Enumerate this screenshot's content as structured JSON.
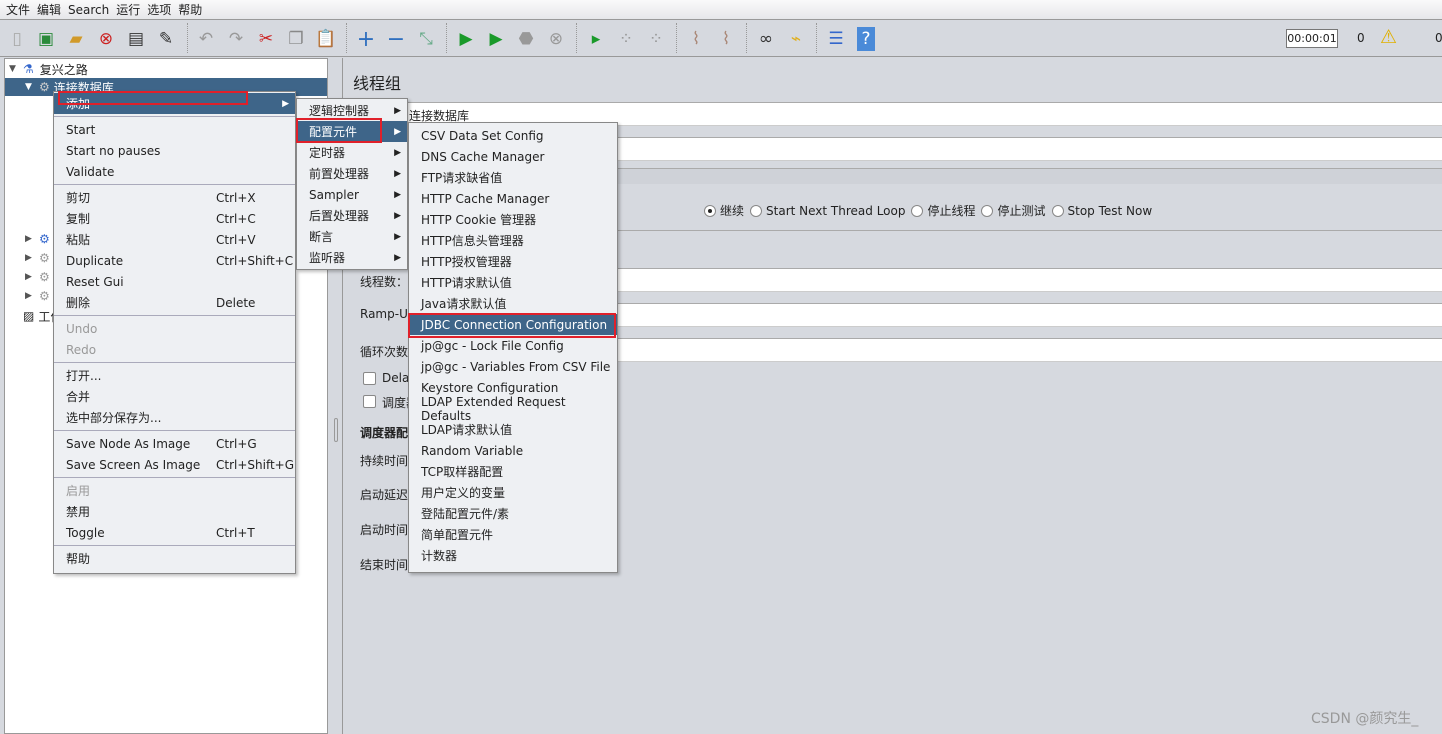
{
  "menubar": [
    "文件",
    "编辑",
    "Search",
    "运行",
    "选项",
    "帮助"
  ],
  "toolbar": {
    "timer": "00:00:01",
    "active_count": "0",
    "error_count": "0",
    "icons": [
      "new-icon",
      "templates-icon",
      "open-icon",
      "close-icon",
      "save-icon",
      "save-as-icon",
      "undo-icon",
      "redo-icon",
      "cut-icon",
      "copy-icon",
      "paste-icon",
      "expand-icon",
      "collapse-icon",
      "toggle-icon",
      "start-icon",
      "start-no-pause-icon",
      "stop-icon",
      "shutdown-icon",
      "remote-start-icon",
      "remote-stop-icon",
      "remote-exit-icon",
      "clear-icon",
      "clear-all-icon",
      "search-icon",
      "reset-search-icon",
      "function-helper-icon",
      "help-icon",
      "warning-icon"
    ]
  },
  "tree": {
    "root": "复兴之路",
    "selected": "连接数据库",
    "workbench": "工作台"
  },
  "panel": {
    "title": "线程组",
    "name_value": "连接数据库",
    "radios": [
      "继续",
      "Start Next Thread Loop",
      "停止线程",
      "停止测试",
      "Stop Test Now"
    ],
    "selected_radio": 0,
    "threads_label": "线程数：",
    "rampup_label": "Ramp-U",
    "loop_label": "循环次数",
    "delay_label": "Dela",
    "scheduler_label": "调度器",
    "scheduler_section": "调度器配",
    "duration_label": "持续时间",
    "startup_delay_label": "启动延迟",
    "start_time_label": "启动时间",
    "end_time_label": "结束时间"
  },
  "context_menu": [
    {
      "label": "添加",
      "arrow": true,
      "highlight": true
    },
    {
      "sep": true
    },
    {
      "label": "Start"
    },
    {
      "label": "Start no pauses"
    },
    {
      "label": "Validate"
    },
    {
      "sep": true
    },
    {
      "label": "剪切",
      "shortcut": "Ctrl+X"
    },
    {
      "label": "复制",
      "shortcut": "Ctrl+C"
    },
    {
      "label": "粘贴",
      "shortcut": "Ctrl+V"
    },
    {
      "label": "Duplicate",
      "shortcut": "Ctrl+Shift+C"
    },
    {
      "label": "Reset Gui"
    },
    {
      "label": "删除",
      "shortcut": "Delete"
    },
    {
      "sep": true
    },
    {
      "label": "Undo",
      "disabled": true
    },
    {
      "label": "Redo",
      "disabled": true
    },
    {
      "sep": true
    },
    {
      "label": "打开..."
    },
    {
      "label": "合并"
    },
    {
      "label": "选中部分保存为..."
    },
    {
      "sep": true
    },
    {
      "label": "Save Node As Image",
      "shortcut": "Ctrl+G"
    },
    {
      "label": "Save Screen As Image",
      "shortcut": "Ctrl+Shift+G"
    },
    {
      "sep": true
    },
    {
      "label": "启用",
      "disabled": true
    },
    {
      "label": "禁用"
    },
    {
      "label": "Toggle",
      "shortcut": "Ctrl+T"
    },
    {
      "sep": true
    },
    {
      "label": "帮助"
    }
  ],
  "submenu_add": [
    "逻辑控制器",
    "配置元件",
    "定时器",
    "前置处理器",
    "Sampler",
    "后置处理器",
    "断言",
    "监听器"
  ],
  "submenu_add_selected": 1,
  "submenu_config": [
    "CSV Data Set Config",
    "DNS Cache Manager",
    "FTP请求缺省值",
    "HTTP Cache Manager",
    "HTTP Cookie 管理器",
    "HTTP信息头管理器",
    "HTTP授权管理器",
    "HTTP请求默认值",
    "Java请求默认值",
    "JDBC Connection Configuration",
    "jp@gc - Lock File Config",
    "jp@gc - Variables From CSV File",
    "Keystore Configuration",
    "LDAP Extended Request Defaults",
    "LDAP请求默认值",
    "Random Variable",
    "TCP取样器配置",
    "用户定义的变量",
    "登陆配置元件/素",
    "简单配置元件",
    "计数器"
  ],
  "submenu_config_selected": 9,
  "watermark": "CSDN @颜究生_"
}
